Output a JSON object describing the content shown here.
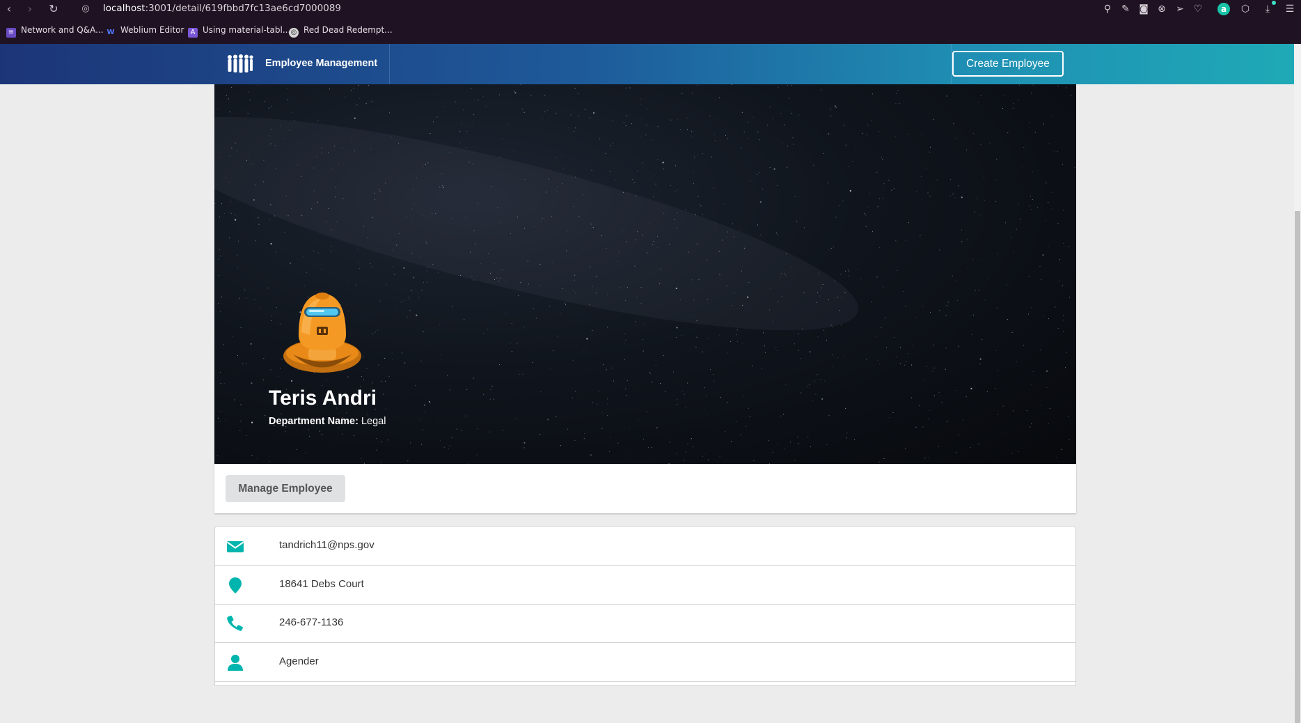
{
  "browser": {
    "url_host": "localhost",
    "url_rest": ":3001/detail/619fbbd7fc13ae6cd7000089",
    "bookmarks": [
      {
        "label": "Network and Q&A...",
        "icon": "list-icon",
        "color": "#6a4bc4"
      },
      {
        "label": "Weblium Editor",
        "icon": "weblium-icon",
        "color": "#3a5bd9"
      },
      {
        "label": "Using material-tabl...",
        "icon": "material-icon",
        "color": "#7b57d6"
      },
      {
        "label": "Red Dead Redempt...",
        "icon": "game-icon",
        "color": "#888888"
      }
    ]
  },
  "navbar": {
    "brand": "Employee Management",
    "create_button": "Create Employee"
  },
  "profile": {
    "name": "Teris Andri",
    "department_label": "Department Name:",
    "department_value": "Legal"
  },
  "actions": {
    "manage_button": "Manage Employee"
  },
  "details": {
    "email": "tandrich11@nps.gov",
    "address": "18641 Debs Court",
    "phone": "246-677-1136",
    "gender": "Agender"
  },
  "colors": {
    "accent": "#00b5ad",
    "navbar_start": "#1c3578",
    "navbar_end": "#1fa9b6"
  }
}
